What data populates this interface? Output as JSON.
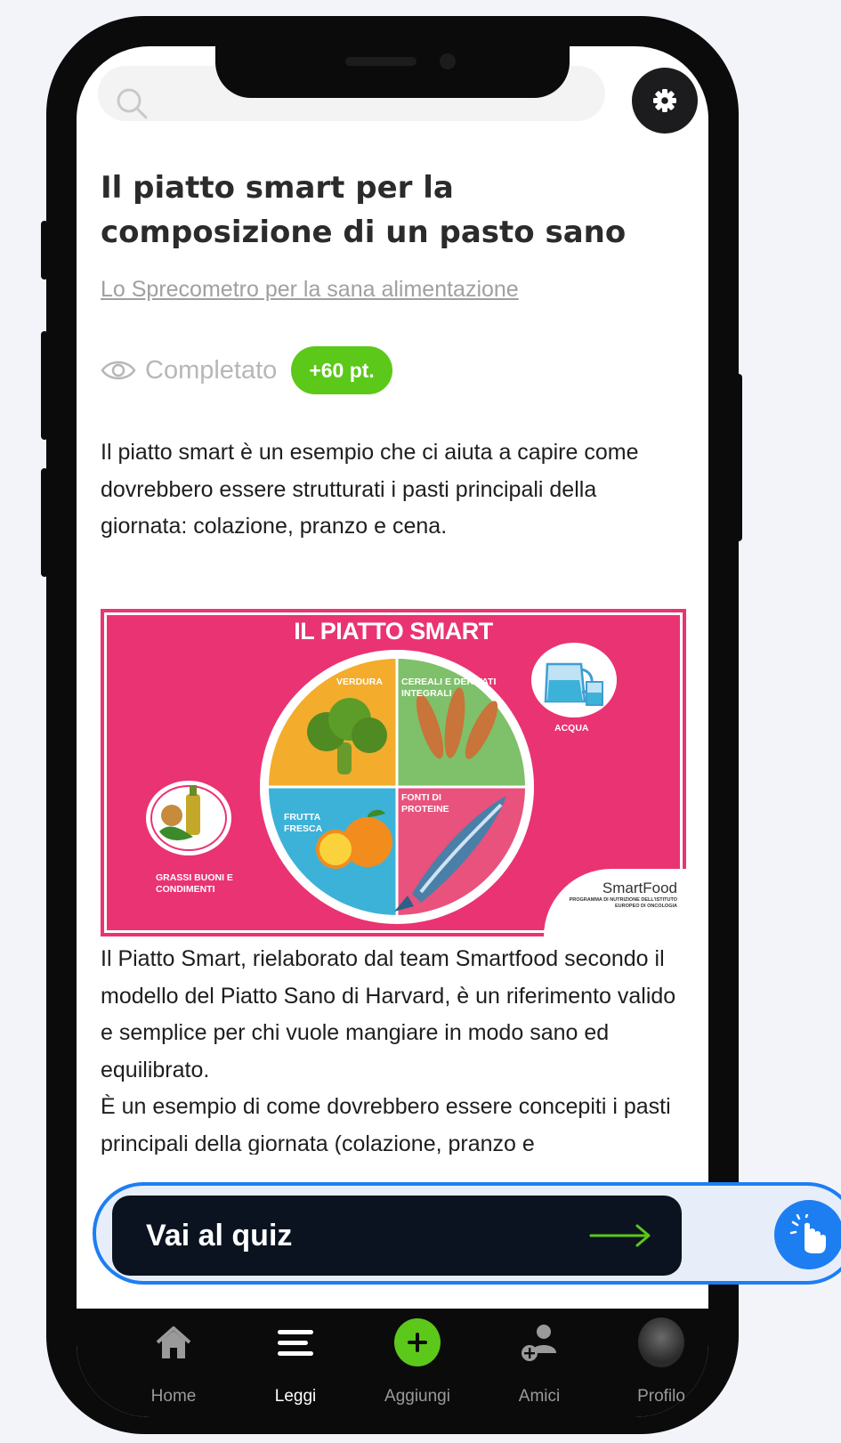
{
  "article": {
    "title": "Il piatto smart per la composizione di un pasto sano",
    "subtitle_link": "Lo Sprecometro per la sana alimentazione",
    "status": "Completato",
    "points_badge": "+60 pt.",
    "intro": "Il piatto smart è un esempio che ci aiuta a capire come dovrebbero essere strutturati i pasti principali della giornata: colazione, pranzo e cena.",
    "body": "Il Piatto Smart, rielaborato dal team Smartfood secondo il modello del Piatto Sano di Harvard, è un riferimento valido e semplice per chi vuole mangiare in modo sano ed equilibrato.\nÈ un esempio di come dovrebbero essere concepiti i pasti principali della giornata (colazione, pranzo e"
  },
  "infographic": {
    "title": "IL PIATTO SMART",
    "label_verdura": "VERDURA",
    "label_cereali": "CEREALI E DERIVATI INTEGRALI",
    "label_proteine": "FONTI DI PROTEINE",
    "label_frutta": "FRUTTA FRESCA",
    "label_acqua": "ACQUA",
    "label_grassi": "GRASSI BUONI E CONDIMENTI",
    "brand": "SmartFood",
    "brand_tagline": "PROGRAMMA DI NUTRIZIONE DELL'ISTITUTO EUROPEO DI ONCOLOGIA"
  },
  "quiz": {
    "label": "Vai al quiz"
  },
  "nav": {
    "items": [
      {
        "label": "Home",
        "icon": "home-icon"
      },
      {
        "label": "Leggi",
        "icon": "menu-icon",
        "active": true
      },
      {
        "label": "Aggiungi",
        "icon": "plus-icon"
      },
      {
        "label": "Amici",
        "icon": "add-friend-icon"
      },
      {
        "label": "Profilo",
        "icon": "avatar"
      }
    ]
  },
  "colors": {
    "accent_green": "#5cc81a",
    "highlight_blue": "#1d7ef2",
    "infographic_pink": "#ea3372",
    "dark": "#0b1320"
  }
}
